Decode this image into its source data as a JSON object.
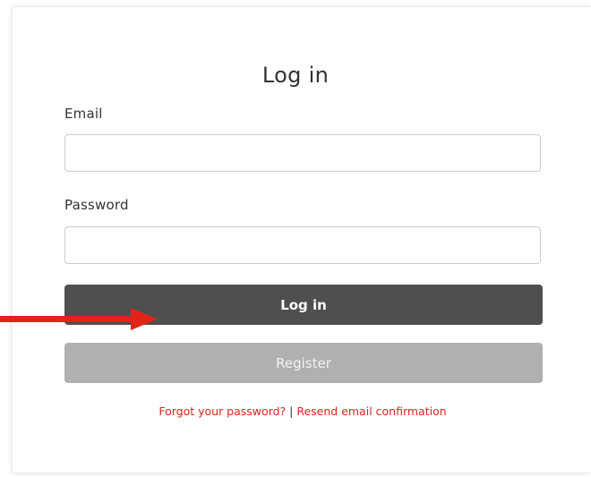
{
  "form": {
    "title": "Log in",
    "email_label": "Email",
    "email_value": "",
    "password_label": "Password",
    "password_value": "",
    "login_button": "Log in",
    "register_button": "Register",
    "forgot_link": "Forgot your password?",
    "separator": "|",
    "resend_link": "Resend email confirmation"
  },
  "colors": {
    "login_button_bg": "#4f4f4f",
    "register_button_bg": "#b0b0b0",
    "link": "#d9261c",
    "annotation_arrow": "#e2231a"
  },
  "annotation": {
    "icon": "red-arrow-icon"
  }
}
